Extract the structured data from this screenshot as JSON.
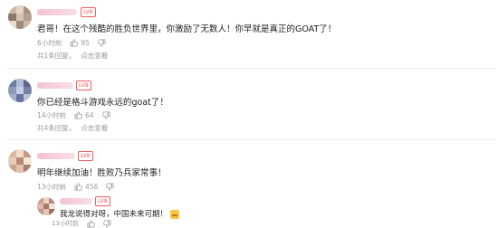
{
  "comments": [
    {
      "level_badge": "LV8",
      "text": "君哥！在这个残酷的胜负世界里，你激励了无数人！你早就是真正的GOAT了！",
      "time": "6小时前",
      "likes": "95",
      "reply_count_text": "共1条回复，",
      "reply_link_text": "点击查看"
    },
    {
      "level_badge": "LV8",
      "text": "你已经是格斗游戏永远的goat了！",
      "time": "14小时前",
      "likes": "64",
      "reply_count_text": "共4条回复，",
      "reply_link_text": "点击查看"
    },
    {
      "level_badge": "LV8",
      "text": "明年继续加油！胜败乃兵家常事！",
      "time": "13小时前",
      "likes": "456",
      "reply": {
        "level_badge": "LV8",
        "text": "我龙说得对呀，中国未来可期！",
        "time": "13小时前"
      }
    }
  ],
  "icons": {
    "like": "thumbs-up-icon",
    "dislike": "thumbs-down-icon"
  },
  "colors": {
    "level_badge": "#f25d5d",
    "meta_text": "#999999",
    "username_blur": "#f4c2cf"
  }
}
